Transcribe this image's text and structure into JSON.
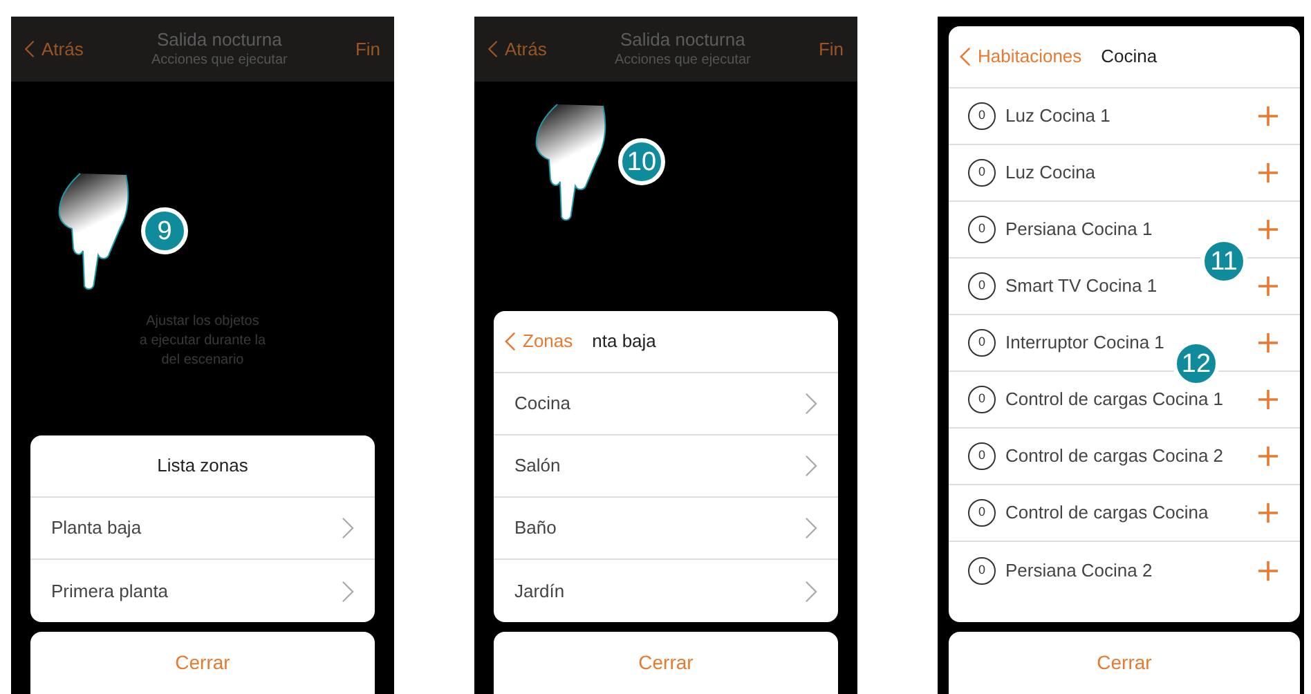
{
  "screens": [
    {
      "header": {
        "back": "Atrás",
        "title": "Salida nocturna",
        "subtitle": "Acciones que ejecutar",
        "done": "Fin"
      },
      "step": "9",
      "hint": [
        "Ajustar los objetos",
        "a ejecutar durante la",
        "del escenario"
      ],
      "sheet": {
        "title": "Lista zonas",
        "rows": [
          {
            "kind": "nav",
            "label": "Planta baja"
          },
          {
            "kind": "nav",
            "label": "Primera planta"
          }
        ]
      },
      "close": "Cerrar"
    },
    {
      "header": {
        "back": "Atrás",
        "title": "Salida nocturna",
        "subtitle": "Acciones que ejecutar",
        "done": "Fin"
      },
      "step": "10",
      "sheet": {
        "back": "Zonas",
        "title": "nta baja",
        "rows": [
          {
            "kind": "nav",
            "label": "Cocina"
          },
          {
            "kind": "nav",
            "label": "Salón"
          },
          {
            "kind": "nav",
            "label": "Baño"
          },
          {
            "kind": "nav",
            "label": "Jardín"
          }
        ]
      },
      "close": "Cerrar"
    },
    {
      "steps": [
        "11",
        "12"
      ],
      "sheet": {
        "back": "Habitaciones",
        "title": "Cocina",
        "rows": [
          {
            "kind": "object",
            "count": "0",
            "label": "Luz Cocina 1"
          },
          {
            "kind": "object",
            "count": "0",
            "label": "Luz Cocina"
          },
          {
            "kind": "object",
            "count": "0",
            "label": "Persiana Cocina 1"
          },
          {
            "kind": "object",
            "count": "0",
            "label": "Smart TV Cocina 1"
          },
          {
            "kind": "object",
            "count": "0",
            "label": "Interruptor Cocina 1"
          },
          {
            "kind": "object",
            "count": "0",
            "label": "Control de cargas Cocina 1"
          },
          {
            "kind": "object",
            "count": "0",
            "label": "Control de cargas Cocina 2"
          },
          {
            "kind": "object",
            "count": "0",
            "label": "Control de cargas Cocina"
          },
          {
            "kind": "object",
            "count": "0",
            "label": "Persiana Cocina 2"
          }
        ]
      },
      "close": "Cerrar"
    }
  ]
}
